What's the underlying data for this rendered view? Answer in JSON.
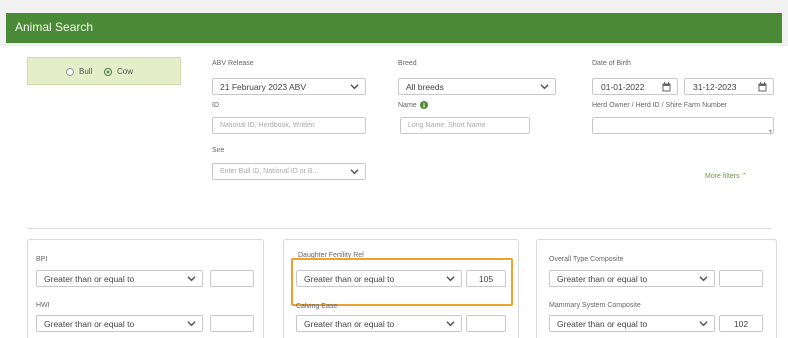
{
  "header": {
    "title": "Animal Search"
  },
  "sex": {
    "bull_label": "Bull",
    "cow_label": "Cow",
    "selected": "Cow"
  },
  "filters": {
    "abv_release": {
      "label": "ABV Release",
      "value": "21 February 2023 ABV"
    },
    "breed": {
      "label": "Breed",
      "value": "All breeds"
    },
    "date_of_birth": {
      "label": "Date of Birth",
      "from": "01-01-2022",
      "to": "31-12-2023"
    },
    "id": {
      "label": "ID",
      "placeholder": "National ID, Herdbook, Written"
    },
    "name": {
      "label": "Name",
      "placeholder": "Long Name, Short Name"
    },
    "herd_owner": {
      "label": "Herd Owner / Herd ID / Shire Farm Number",
      "value": ""
    },
    "sire": {
      "label": "Sire",
      "placeholder": "Enter Bull ID, National ID or B..."
    },
    "more_filters": "More filters ⌃"
  },
  "traits": {
    "bpi": {
      "label": "BPI",
      "operator": "Greater than or equal to",
      "value": ""
    },
    "hwi": {
      "label": "HWI",
      "operator": "Greater than or equal to",
      "value": ""
    },
    "daughter_fertility": {
      "label": "Daughter Fertility Rel",
      "operator": "Greater than or equal to",
      "value": "105"
    },
    "calving_ease": {
      "label": "Calving Ease",
      "operator": "Greater than or equal to",
      "value": ""
    },
    "overall_type": {
      "label": "Overall Type Composite",
      "operator": "Greater than or equal to",
      "value": ""
    },
    "mammary": {
      "label": "Mammary System Composite",
      "operator": "Greater than or equal to",
      "value": "102"
    }
  },
  "colors": {
    "brand_green": "#4a8a36",
    "highlight": "#f0a030",
    "sex_box_bg": "#e6eec9"
  },
  "icons": {
    "dropdown": "chevron-down-icon",
    "calendar": "calendar-icon",
    "info": "info-icon"
  }
}
